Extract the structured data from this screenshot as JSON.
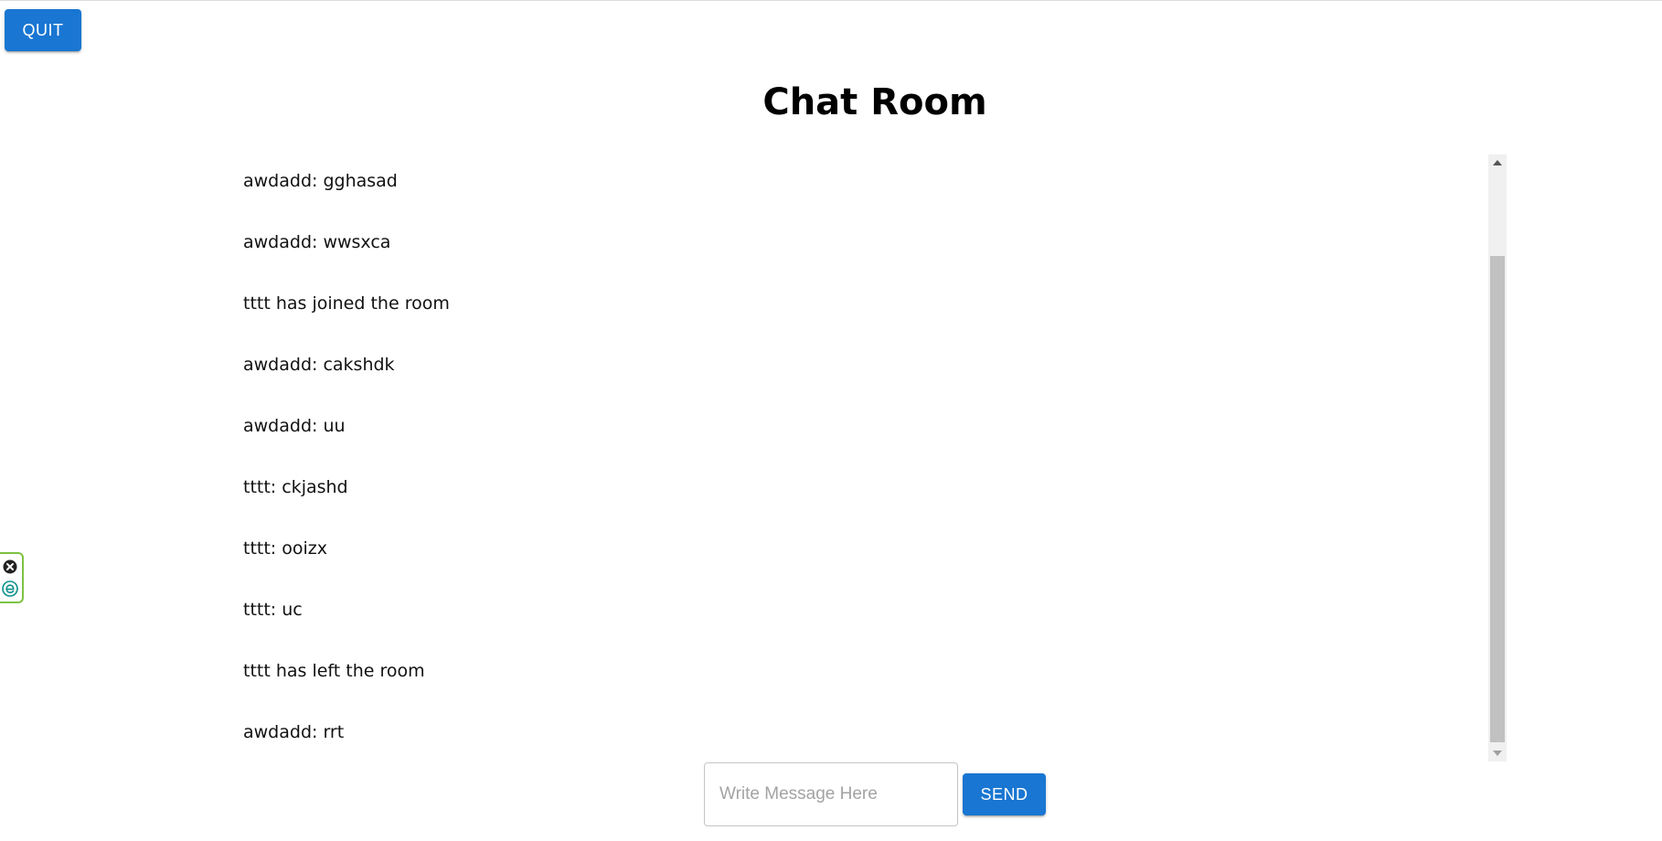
{
  "header": {
    "quit_label": "QUIT",
    "title": "Chat Room"
  },
  "messages": [
    "awdadd: gghasad",
    "awdadd: wwsxca",
    "tttt has joined the room",
    "awdadd: cakshdk",
    "awdadd: uu",
    "tttt: ckjashd",
    "tttt: ooizx",
    "tttt: uc",
    "tttt has left the room",
    "awdadd: rrt"
  ],
  "composer": {
    "placeholder": "Write Message Here",
    "value": "",
    "send_label": "SEND"
  },
  "colors": {
    "accent": "#1976d2",
    "widget_border": "#7cc242"
  },
  "icons": {
    "widget_close": "close-circle-icon",
    "widget_edge": "edge-e-icon"
  }
}
